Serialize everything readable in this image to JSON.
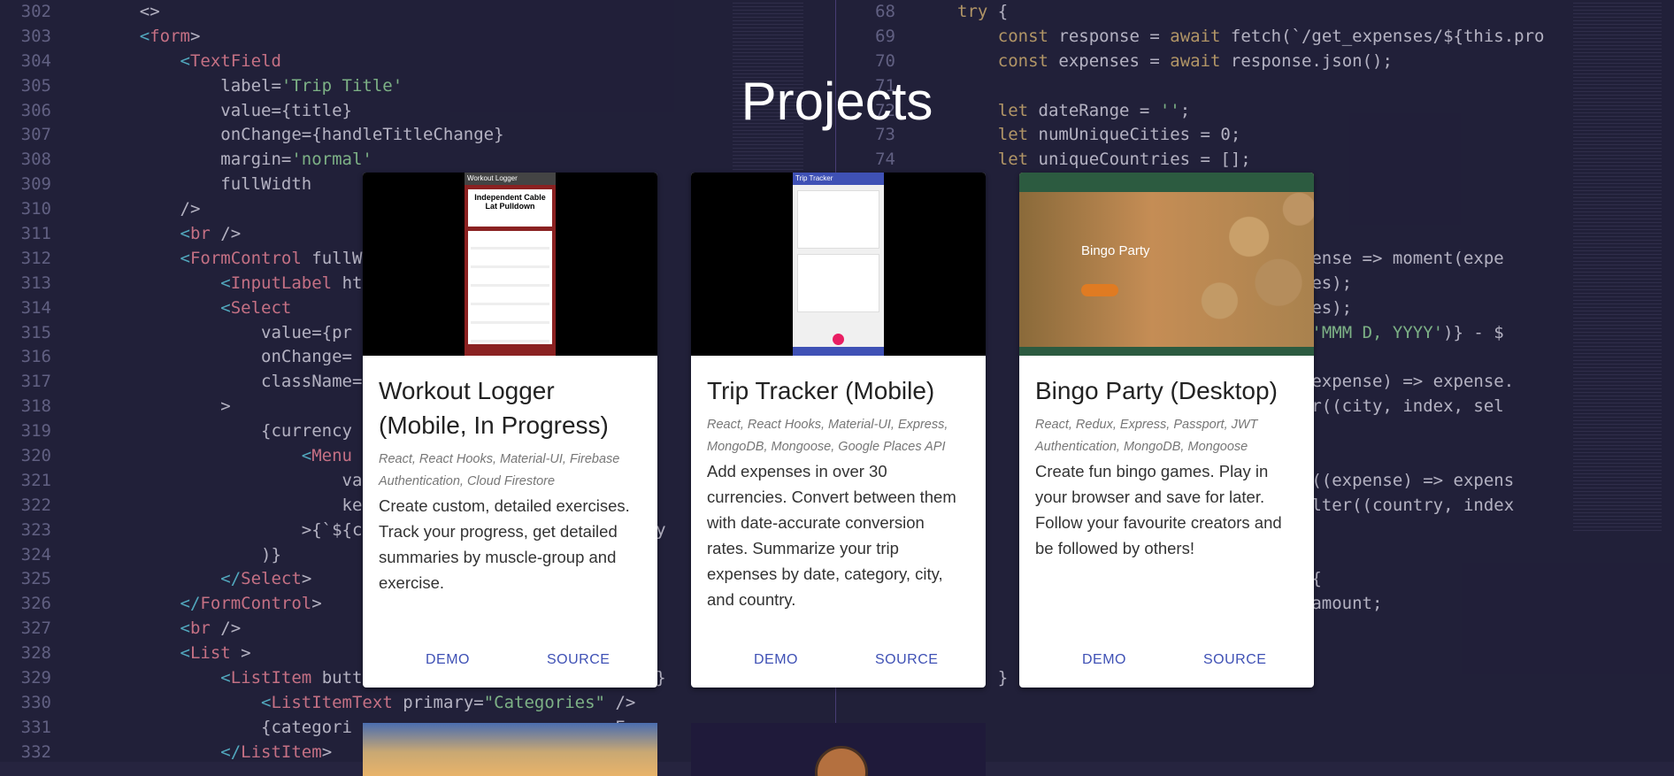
{
  "background_code": {
    "left": [
      {
        "n": "302",
        "code": "    <>"
      },
      {
        "n": "303",
        "code": "    <form>"
      },
      {
        "n": "304",
        "code": "        <TextField"
      },
      {
        "n": "305",
        "code": "            label='Trip Title'"
      },
      {
        "n": "306",
        "code": "            value={title}"
      },
      {
        "n": "307",
        "code": "            onChange={handleTitleChange}"
      },
      {
        "n": "308",
        "code": "            margin='normal'"
      },
      {
        "n": "309",
        "code": "            fullWidth"
      },
      {
        "n": "310",
        "code": "        />"
      },
      {
        "n": "311",
        "code": "        <br />"
      },
      {
        "n": "312",
        "code": "        <FormControl fullW"
      },
      {
        "n": "313",
        "code": "            <InputLabel ht                      Inpu"
      },
      {
        "n": "314",
        "code": "            <Select"
      },
      {
        "n": "315",
        "code": "                value={pr"
      },
      {
        "n": "316",
        "code": "                onChange=                          }"
      },
      {
        "n": "317",
        "code": "                className="
      },
      {
        "n": "318",
        "code": "            >"
      },
      {
        "n": "319",
        "code": "                {currency"
      },
      {
        "n": "320",
        "code": "                    <Menu"
      },
      {
        "n": "321",
        "code": "                        va"
      },
      {
        "n": "322",
        "code": "                        ke"
      },
      {
        "n": "323",
        "code": "                    >{`${c                          ency"
      },
      {
        "n": "324",
        "code": "                )}"
      },
      {
        "n": "325",
        "code": "            </Select>"
      },
      {
        "n": "326",
        "code": "        </FormControl>"
      },
      {
        "n": "327",
        "code": "        <br />"
      },
      {
        "n": "328",
        "code": "        <List >"
      },
      {
        "n": "329",
        "code": "            <ListItem butt                          ies}"
      },
      {
        "n": "330",
        "code": "                <ListItemText primary=\"Categories\" />"
      },
      {
        "n": "331",
        "code": "                {categori                          Exp"
      },
      {
        "n": "332",
        "code": "            </ListItem>"
      }
    ],
    "right": [
      {
        "n": "68",
        "code": "try {"
      },
      {
        "n": "69",
        "code": "    const response = await fetch(`/get_expenses/${this.pro"
      },
      {
        "n": "70",
        "code": "    const expenses = await response.json();"
      },
      {
        "n": "71",
        "code": ""
      },
      {
        "n": "72",
        "code": "    let dateRange = '';"
      },
      {
        "n": "73",
        "code": "    let numUniqueCities = 0;"
      },
      {
        "n": "74",
        "code": "    let uniqueCountries = [];"
      },
      {
        "n": "",
        "code": ""
      },
      {
        "n": "",
        "code": ""
      },
      {
        "n": "",
        "code": ""
      },
      {
        "n": "",
        "code": "                            map(expense => moment(expe"
      },
      {
        "n": "",
        "code": "                            max(dates);"
      },
      {
        "n": "",
        "code": "                            min(dates);"
      },
      {
        "n": "",
        "code": "                            format('MMM D, YYYY')} - $"
      },
      {
        "n": "",
        "code": "                            cities"
      },
      {
        "n": "",
        "code": "                            s.map((expense) => expense."
      },
      {
        "n": "",
        "code": "                            s.filter((city, index, sel"
      },
      {
        "n": "",
        "code": ""
      },
      {
        "n": "",
        "code": ""
      },
      {
        "n": "",
        "code": "                            ses.map((expense) => expens"
      },
      {
        "n": "",
        "code": "                            ries.filter((country, index"
      },
      {
        "n": "",
        "code": ""
      },
      {
        "n": "",
        "code": ""
      },
      {
        "n": "",
        "code": "                            se) => {"
      },
      {
        "n": "",
        "code": "                            e.cost.amount;"
      },
      {
        "n": "",
        "code": ""
      },
      {
        "n": "",
        "code": ""
      },
      {
        "n": "96",
        "code": "    }"
      }
    ]
  },
  "page": {
    "title": "Projects"
  },
  "projects": [
    {
      "title": "Workout Logger (Mobile, In Progress)",
      "tech": "React, React Hooks, Material-UI, Firebase Authentication, Cloud Firestore",
      "description": "Create custom, detailed exercises. Track your progress, get detailed summaries by muscle-group and exercise.",
      "demo_label": "DEMO",
      "source_label": "SOURCE",
      "screenshot": {
        "app_bar": "Workout Logger",
        "heading": "Independent Cable Lat Pulldown"
      }
    },
    {
      "title": "Trip Tracker (Mobile)",
      "tech": "React, React Hooks, Material-UI, Express, MongoDB, Mongoose, Google Places API",
      "description": "Add expenses in over 30 currencies. Convert between them with date-accurate conversion rates. Summarize your trip expenses by date, category, city, and country.",
      "demo_label": "DEMO",
      "source_label": "SOURCE",
      "screenshot": {
        "app_bar": "Trip Tracker"
      }
    },
    {
      "title": "Bingo Party (Desktop)",
      "tech": "React, Redux, Express, Passport, JWT Authentication, MongoDB, Mongoose",
      "description": "Create fun bingo games. Play in your browser and save for later. Follow your favourite creators and be followed by others!",
      "demo_label": "DEMO",
      "source_label": "SOURCE",
      "screenshot": {
        "hero_title": "Bingo Party"
      }
    }
  ],
  "colors": {
    "background": "#26243f",
    "accent_button": "#3f51b5",
    "card": "#ffffff"
  }
}
